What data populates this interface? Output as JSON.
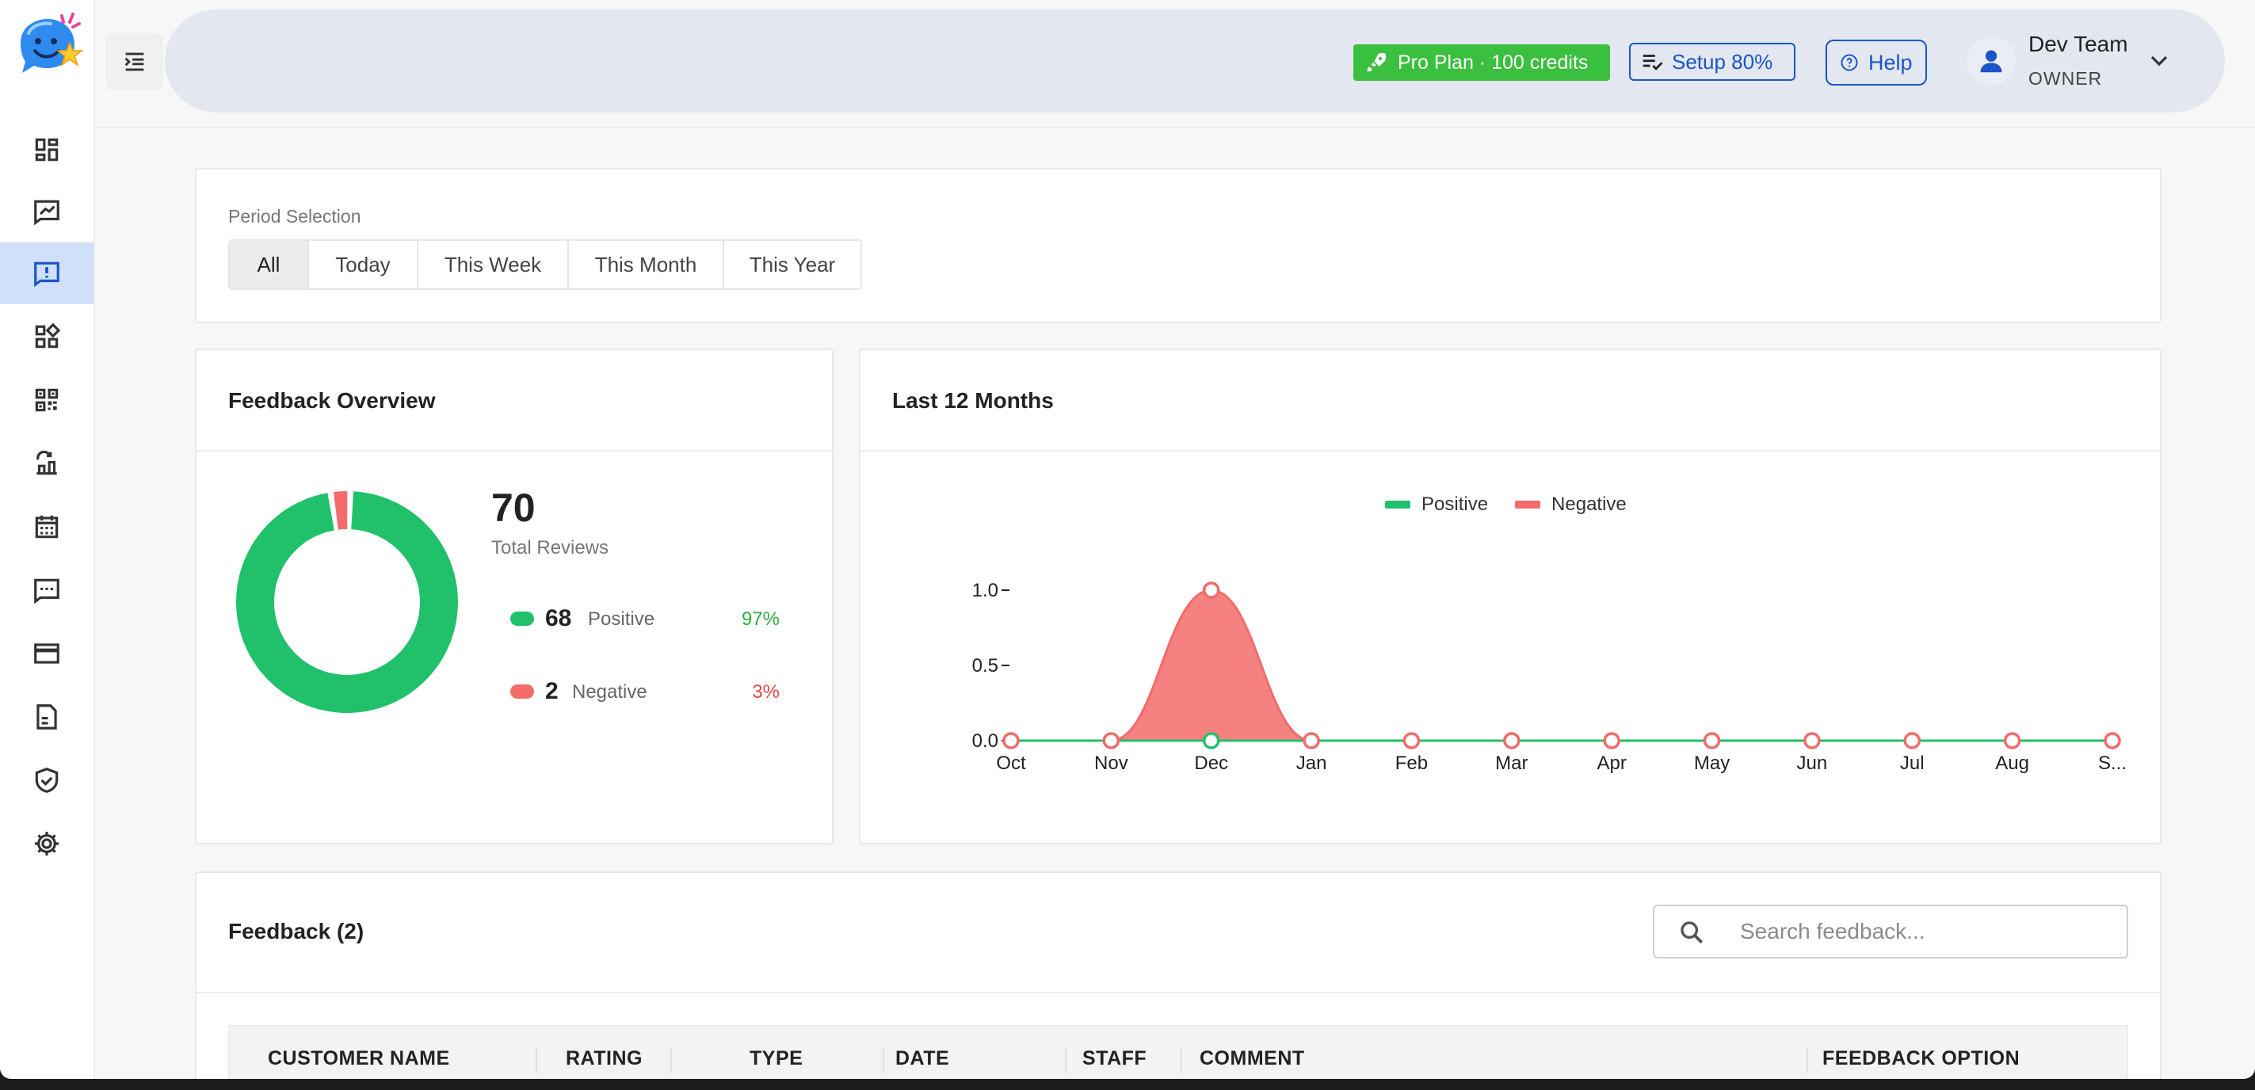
{
  "sidebar": {
    "logo_icon": "smiling-chat-bubble-logo",
    "items": [
      {
        "icon": "dashboard-icon"
      },
      {
        "icon": "review-icon"
      },
      {
        "icon": "feedback-icon",
        "active": true
      },
      {
        "icon": "widgets-icon"
      },
      {
        "icon": "qr-code-icon"
      },
      {
        "icon": "reward-icon"
      },
      {
        "icon": "calendar-icon"
      },
      {
        "icon": "messages-icon"
      },
      {
        "icon": "billing-card-icon"
      },
      {
        "icon": "document-icon"
      },
      {
        "icon": "security-shield-icon"
      },
      {
        "icon": "settings-gear-icon"
      }
    ]
  },
  "header": {
    "plan_badge": "Pro Plan · 100 credits",
    "setup_label": "Setup 80%",
    "help_label": "Help",
    "user_name": "Dev Team",
    "user_role": "OWNER"
  },
  "period": {
    "label": "Period Selection",
    "options": [
      "All",
      "Today",
      "This Week",
      "This Month",
      "This Year"
    ],
    "selected": "All"
  },
  "overview": {
    "title": "Feedback Overview",
    "total": "70",
    "total_label": "Total Reviews",
    "positive_count": "68",
    "positive_label": "Positive",
    "positive_pct": "97%",
    "negative_count": "2",
    "negative_label": "Negative",
    "negative_pct": "3%"
  },
  "trend": {
    "title": "Last 12 Months"
  },
  "feedback": {
    "title": "Feedback (2)",
    "search_placeholder": "Search feedback...",
    "columns": [
      "CUSTOMER NAME",
      "RATING",
      "TYPE",
      "DATE",
      "STAFF",
      "COMMENT",
      "FEEDBACK OPTION"
    ]
  },
  "colors": {
    "positive": "#21c16b",
    "negative": "#f36b6b",
    "accent": "#1a56c9",
    "plan_green": "#3bbf3f",
    "active_nav": "#cfe0fb"
  },
  "chart_data": [
    {
      "type": "pie",
      "variant": "donut",
      "labels": [
        "Positive",
        "Negative"
      ],
      "values": [
        68,
        2
      ]
    },
    {
      "type": "area",
      "categories": [
        "Oct",
        "Nov",
        "Dec",
        "Jan",
        "Feb",
        "Mar",
        "Apr",
        "May",
        "Jun",
        "Jul",
        "Aug",
        "S..."
      ],
      "series": [
        {
          "name": "Positive",
          "values": [
            0,
            0,
            0,
            0,
            0,
            0,
            0,
            0,
            0,
            0,
            0,
            0
          ]
        },
        {
          "name": "Negative",
          "values": [
            0,
            0,
            1,
            0,
            0,
            0,
            0,
            0,
            0,
            0,
            0,
            0
          ]
        }
      ],
      "yticks": [
        "0.0",
        "0.5",
        "1.0"
      ],
      "ylim": [
        0,
        1
      ],
      "legend": "top-center",
      "grid": false
    }
  ]
}
